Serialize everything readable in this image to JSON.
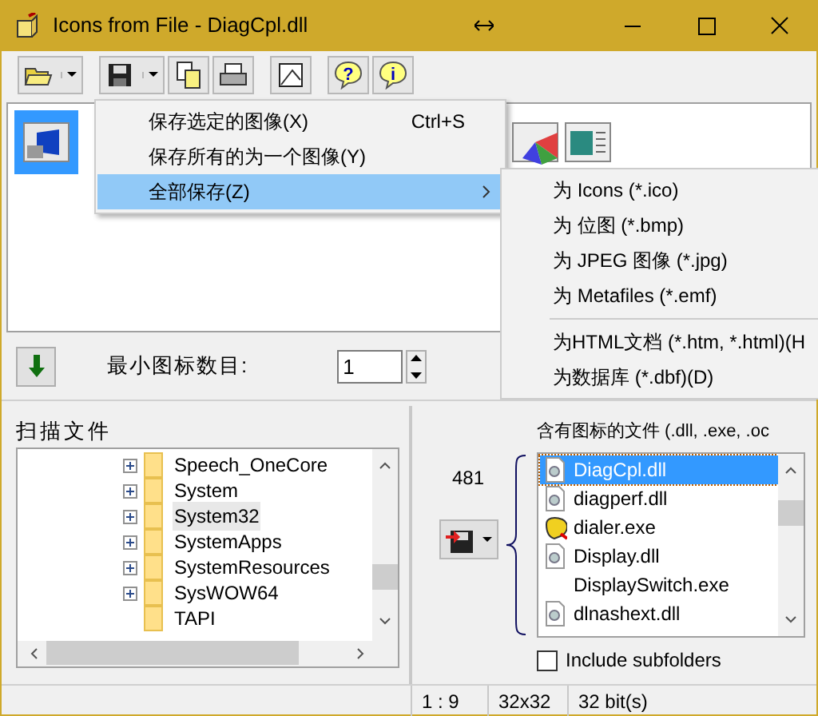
{
  "window": {
    "title": "Icons from File - DiagCpl.dll"
  },
  "toolbar": {
    "help_glyph": "?",
    "info_glyph": "i"
  },
  "icon_pane": {
    "icons": [
      {
        "selected": true
      },
      {
        "selected": false
      },
      {
        "selected": false
      }
    ]
  },
  "save_menu": {
    "items": [
      {
        "label": "保存选定的图像(X)",
        "shortcut": "Ctrl+S",
        "selected": false,
        "submenu": false
      },
      {
        "label": "保存所有的为一个图像(Y)",
        "selected": false,
        "submenu": false
      },
      {
        "label": "全部保存(Z)",
        "selected": true,
        "submenu": true
      }
    ]
  },
  "submenu": {
    "items": [
      {
        "kind": "item",
        "label": "为 Icons (*.ico)"
      },
      {
        "kind": "item",
        "label": "为 位图 (*.bmp)"
      },
      {
        "kind": "item",
        "label": "为 JPEG 图像 (*.jpg)"
      },
      {
        "kind": "item",
        "label": "为 Metafiles (*.emf)"
      },
      {
        "kind": "separator"
      },
      {
        "kind": "item",
        "label": "为HTML文档 (*.htm, *.html)(H"
      },
      {
        "kind": "item",
        "label": "为数据库 (*.dbf)(D)"
      }
    ]
  },
  "min_icons": {
    "label": "最小图标数目:",
    "value": "1"
  },
  "folder_panel": {
    "label": "扫描文件",
    "tree": [
      {
        "label": "Speech_OneCore",
        "expandable": true,
        "selected": false
      },
      {
        "label": "System",
        "expandable": true,
        "selected": false
      },
      {
        "label": "System32",
        "expandable": true,
        "selected": true
      },
      {
        "label": "SystemApps",
        "expandable": true,
        "selected": false
      },
      {
        "label": "SystemResources",
        "expandable": true,
        "selected": false
      },
      {
        "label": "SysWOW64",
        "expandable": true,
        "selected": false
      },
      {
        "label": "TAPI",
        "expandable": false,
        "selected": false
      }
    ]
  },
  "file_panel": {
    "label": "含有图标的文件 (.dll, .exe, .oc",
    "count": "481",
    "files": [
      {
        "label": "DiagCpl.dll",
        "kind": "dll",
        "selected": true
      },
      {
        "label": "diagperf.dll",
        "kind": "dll",
        "selected": false
      },
      {
        "label": "dialer.exe",
        "kind": "exe",
        "selected": false
      },
      {
        "label": "Display.dll",
        "kind": "dll",
        "selected": false
      },
      {
        "label": "DisplaySwitch.exe",
        "kind": "none",
        "selected": false
      },
      {
        "label": "dlnashext.dll",
        "kind": "dll",
        "selected": false
      }
    ],
    "include_subfolders": {
      "label": "Include subfolders",
      "checked": false
    }
  },
  "status_bar": [
    "1 : 9",
    "32x32",
    "32 bit(s)"
  ]
}
